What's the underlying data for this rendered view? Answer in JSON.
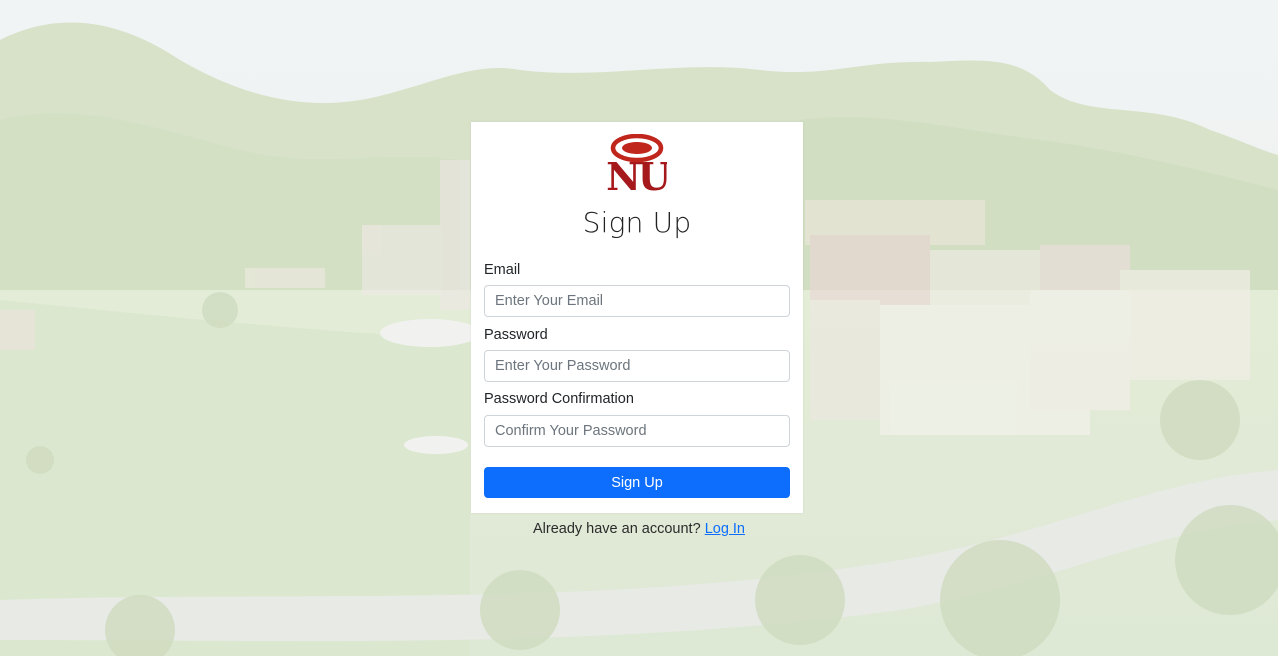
{
  "brand": {
    "logo_text": "NU",
    "logo_color": "#b31b1b"
  },
  "form": {
    "title": "Sign Up",
    "email": {
      "label": "Email",
      "placeholder": "Enter Your Email",
      "value": ""
    },
    "password": {
      "label": "Password",
      "placeholder": "Enter Your Password",
      "value": ""
    },
    "password_confirmation": {
      "label": "Password Confirmation",
      "placeholder": "Confirm Your Password",
      "value": ""
    },
    "submit_label": "Sign Up",
    "submit_color": "#0d6efd"
  },
  "footer": {
    "prompt": "Already have an account?",
    "login_link": "Log In"
  }
}
